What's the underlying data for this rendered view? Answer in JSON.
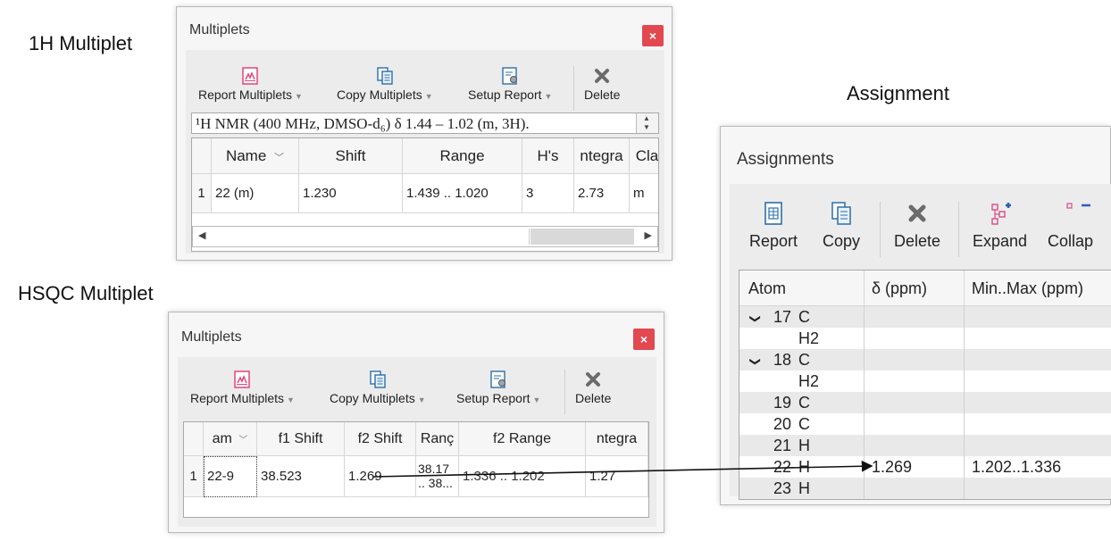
{
  "captions": {
    "h1": "1H Multiplet",
    "hsqc": "HSQC Multiplet",
    "assignment": "Assignment"
  },
  "panel1": {
    "title": "Multiplets",
    "close_label": "×",
    "toolbar": {
      "report": "Report Multiplets",
      "copy": "Copy Multiplets",
      "setup": "Setup Report",
      "delete": "Delete"
    },
    "report_text": "¹H NMR (400 MHz, DMSO-d₆) δ 1.44 – 1.02 (m, 3H).",
    "columns": [
      "Name",
      "Shift",
      "Range",
      "H's",
      "ntegra",
      "Cla"
    ],
    "rows": [
      {
        "num": "1",
        "cells": [
          "22 (m)",
          "1.230",
          "1.439 .. 1.020",
          "3",
          "2.73",
          "m"
        ]
      }
    ]
  },
  "panel2": {
    "title": "Multiplets",
    "close_label": "×",
    "toolbar": {
      "report": "Report Multiplets",
      "copy": "Copy Multiplets",
      "setup": "Setup Report",
      "delete": "Delete"
    },
    "columns": [
      "am",
      "f1 Shift",
      "f2 Shift",
      "Ranç",
      "f2 Range",
      "ntegra"
    ],
    "rows": [
      {
        "num": "1",
        "cells": [
          "22-9",
          "38.523",
          "1.269",
          "38.17",
          "1.336 .. 1.202",
          "1.27"
        ],
        "range_line2": ".. 38..."
      }
    ]
  },
  "panel3": {
    "title": "Assignments",
    "toolbar": {
      "report": "Report",
      "copy": "Copy",
      "delete": "Delete",
      "expand": "Expand",
      "collapse": "Collap"
    },
    "columns": [
      "Atom",
      "δ (ppm)",
      "Min..Max (ppm)"
    ],
    "rows": [
      {
        "chevron": "❯",
        "num": "17",
        "atom": "C",
        "shift": "",
        "range": ""
      },
      {
        "chevron": "",
        "num": "",
        "atom": "H2",
        "shift": "",
        "range": ""
      },
      {
        "chevron": "❯",
        "num": "18",
        "atom": "C",
        "shift": "",
        "range": ""
      },
      {
        "chevron": "",
        "num": "",
        "atom": "H2",
        "shift": "",
        "range": ""
      },
      {
        "chevron": "",
        "num": "19",
        "atom": "C",
        "shift": "",
        "range": ""
      },
      {
        "chevron": "",
        "num": "20",
        "atom": "C",
        "shift": "",
        "range": ""
      },
      {
        "chevron": "",
        "num": "21",
        "atom": "H",
        "shift": "",
        "range": ""
      },
      {
        "chevron": "",
        "num": "22",
        "atom": "H",
        "shift": "1.269",
        "range": "1.202..1.336"
      },
      {
        "chevron": "",
        "num": "23",
        "atom": "H",
        "shift": "",
        "range": ""
      }
    ]
  },
  "colors": {
    "close": "#e24850",
    "report_icon": "#e0457b",
    "expand_icon": "#d84a8a",
    "accent_blue": "#2b5fbf"
  }
}
